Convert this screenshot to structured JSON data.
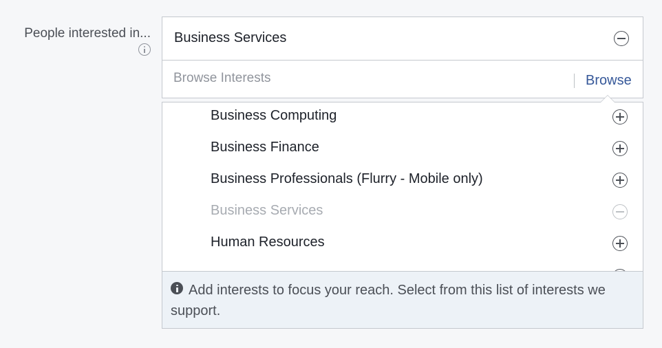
{
  "field": {
    "label": "People interested in...",
    "info_icon": "info-outline-icon"
  },
  "selected": {
    "text": "Business Services",
    "remove_icon": "minus-circle-icon"
  },
  "search": {
    "placeholder": "Browse Interests",
    "value": "",
    "browse_label": "Browse"
  },
  "dropdown": {
    "items": [
      {
        "label": "Business Computing",
        "action_icon": "plus-circle-icon",
        "state": "available"
      },
      {
        "label": "Business Finance",
        "action_icon": "plus-circle-icon",
        "state": "available"
      },
      {
        "label": "Business Professionals (Flurry - Mobile only)",
        "action_icon": "plus-circle-icon",
        "state": "available"
      },
      {
        "label": "Business Services",
        "action_icon": "minus-circle-icon",
        "state": "selected"
      },
      {
        "label": "Human Resources",
        "action_icon": "plus-circle-icon",
        "state": "available"
      }
    ],
    "help_icon": "info-solid-icon",
    "help_text": "Add interests to focus your reach. Select from this list of interests we support."
  },
  "colors": {
    "background": "#f6f7f9",
    "border": "#c4c8ce",
    "text": "#1d2129",
    "muted_text": "#90949c",
    "link": "#365899",
    "help_background": "#edf2f7"
  }
}
